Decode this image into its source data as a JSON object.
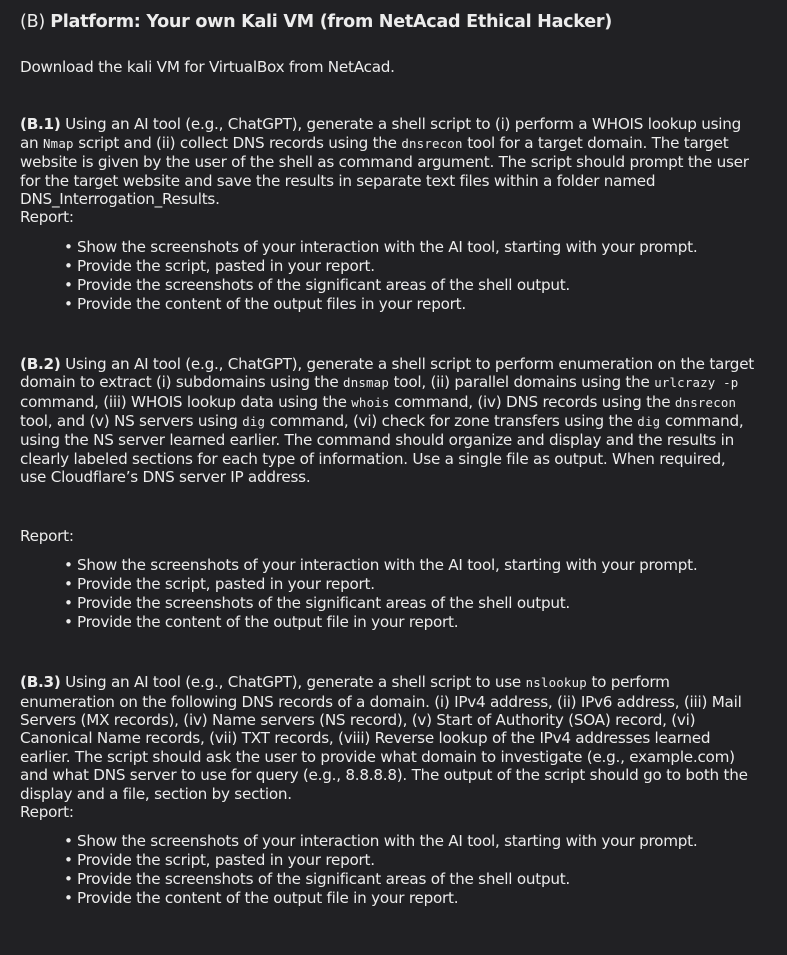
{
  "heading": {
    "prefix": "(B)",
    "title": "Platform: Your own Kali VM (from NetAcad Ethical Hacker)"
  },
  "intro": "Download the kali VM for VirtualBox from NetAcad.",
  "sections": [
    {
      "label": "(B.1)",
      "parts": [
        " Using an AI tool (e.g., ChatGPT), generate a shell script to (i) perform a WHOIS lookup using an ",
        "Nmap",
        " script and (ii) collect DNS records using the ",
        "dnsrecon",
        " tool for a target domain. The target website is given by the user of the shell as command argument. The script should prompt the user for the target website and save the results in separate text files within a folder named DNS_Interrogation_Results."
      ],
      "report_label": "Report:",
      "bullets": [
        "Show the screenshots of your interaction with the AI tool, starting with your prompt.",
        "Provide the script, pasted in your report.",
        "Provide the screenshots of the significant areas of the shell output.",
        "Provide the content of the output files in your report."
      ]
    },
    {
      "label": "(B.2)",
      "parts": [
        " Using an AI tool (e.g., ChatGPT), generate a shell script to perform enumeration on the target domain to extract (i) subdomains using the ",
        "dnsmap",
        " tool, (ii) parallel domains using the ",
        "urlcrazy -p",
        " command, (iii) WHOIS lookup data using the ",
        "whois",
        " command, (iv) DNS records using the ",
        "dnsrecon",
        " tool, and (v) NS servers using ",
        "dig",
        " command, (vi) check for zone transfers using the ",
        "dig",
        " command, using the NS server learned earlier. The command should organize and display and the results in clearly labeled sections for each type of information. Use a single file as output. When required, use Cloudflare’s DNS server IP address."
      ],
      "report_label": "Report:",
      "bullets": [
        "Show the screenshots of your interaction with the AI tool, starting with your prompt.",
        "Provide the script, pasted in your report.",
        "Provide the screenshots of the significant areas of the shell output.",
        "Provide the content of the output file in your report."
      ]
    },
    {
      "label": "(B.3)",
      "parts": [
        " Using an AI tool (e.g., ChatGPT), generate a shell script to use ",
        "nslookup",
        " to perform enumeration on the following DNS records of a domain. (i) IPv4 address, (ii) IPv6 address, (iii) Mail Servers (MX records), (iv) Name servers (NS record), (v) Start of Authority (SOA) record, (vi) Canonical Name records, (vii) TXT records, (viii) Reverse lookup of the IPv4 addresses learned earlier. The script should ask the user to provide what domain to investigate (e.g., example.com) and what DNS server to use for query (e.g., 8.8.8.8). The output of the script should go to both the display and a file, section by section."
      ],
      "report_label": "Report:",
      "bullets": [
        "Show the screenshots of your interaction with the AI tool, starting with your prompt.",
        "Provide the script, pasted in your report.",
        "Provide the screenshots of the significant areas of the shell output.",
        "Provide the content of the output file in your report."
      ]
    }
  ]
}
